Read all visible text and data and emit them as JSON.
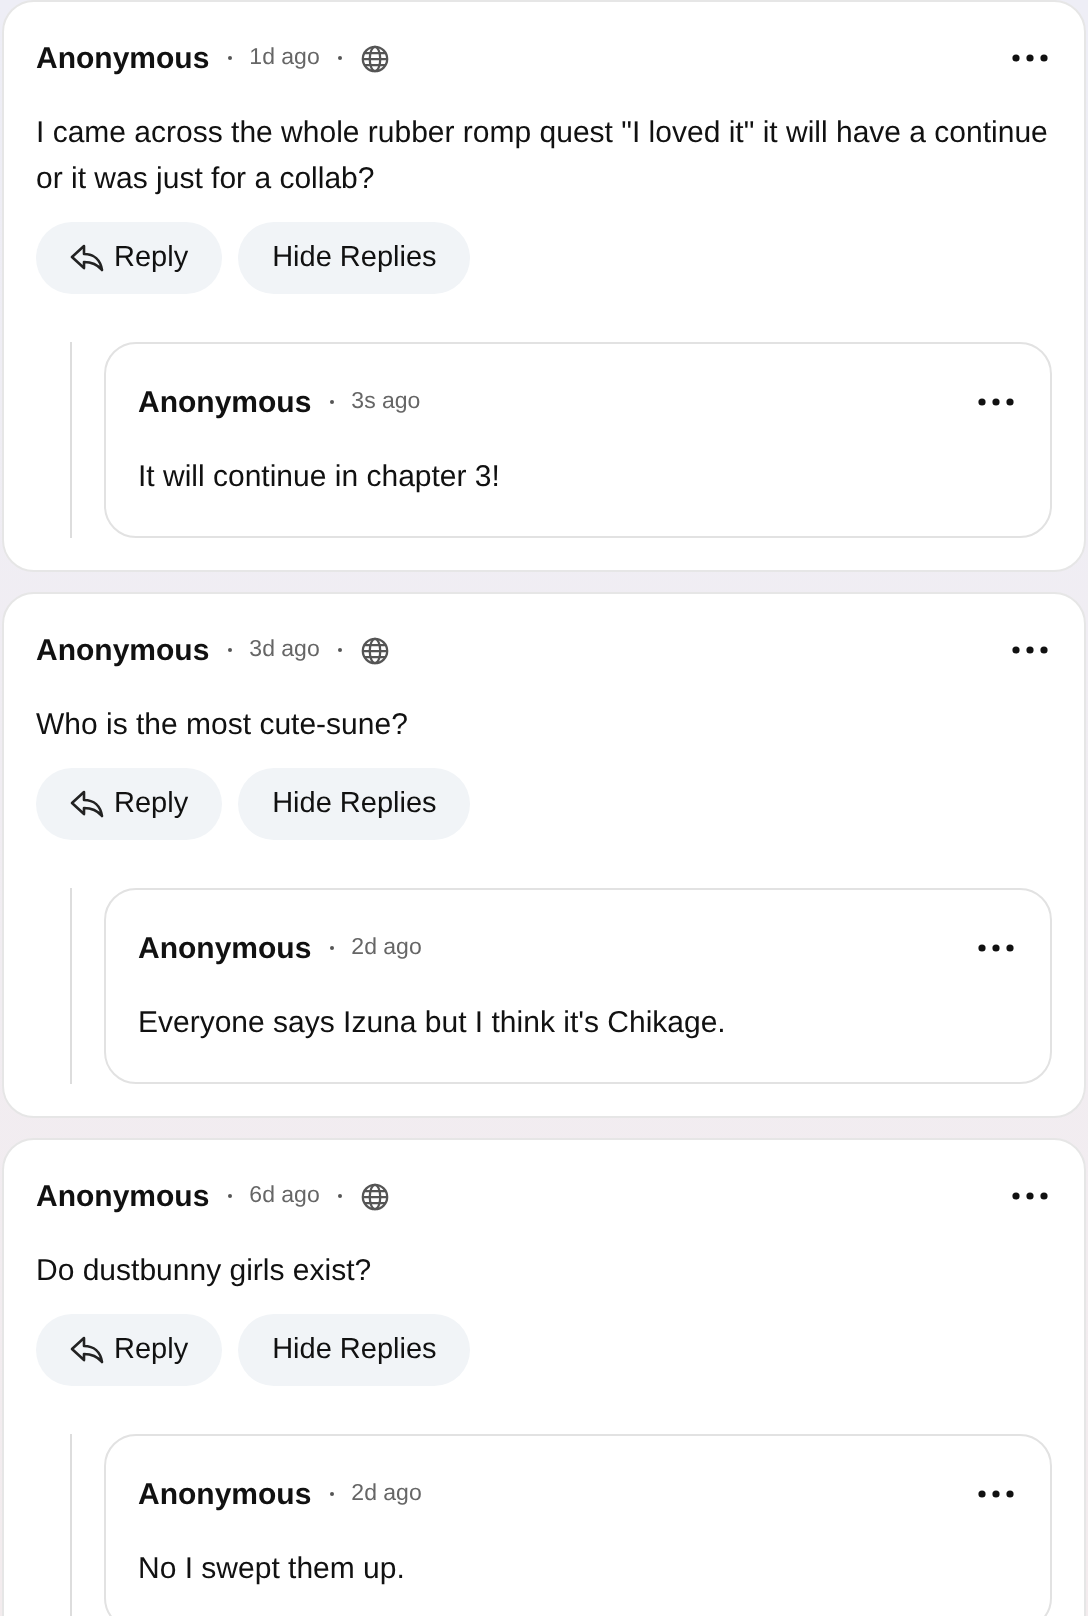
{
  "comments": [
    {
      "author": "Anonymous",
      "time": "1d ago",
      "text": "I came across the whole rubber romp quest \"I loved it\" it will have a continue or it was just for a collab?",
      "reply_button": "Reply",
      "hide_button": "Hide Replies",
      "replies": [
        {
          "author": "Anonymous",
          "time": "3s ago",
          "text": "It will continue in chapter 3!"
        }
      ]
    },
    {
      "author": "Anonymous",
      "time": "3d ago",
      "text": "Who is the most cute-sune?",
      "reply_button": "Reply",
      "hide_button": "Hide Replies",
      "replies": [
        {
          "author": "Anonymous",
          "time": "2d ago",
          "text": "Everyone says Izuna but I think it's Chikage."
        }
      ]
    },
    {
      "author": "Anonymous",
      "time": "6d ago",
      "text": "Do dustbunny girls exist?",
      "reply_button": "Reply",
      "hide_button": "Hide Replies",
      "replies": [
        {
          "author": "Anonymous",
          "time": "2d ago",
          "text": "No I swept them up."
        }
      ]
    }
  ]
}
